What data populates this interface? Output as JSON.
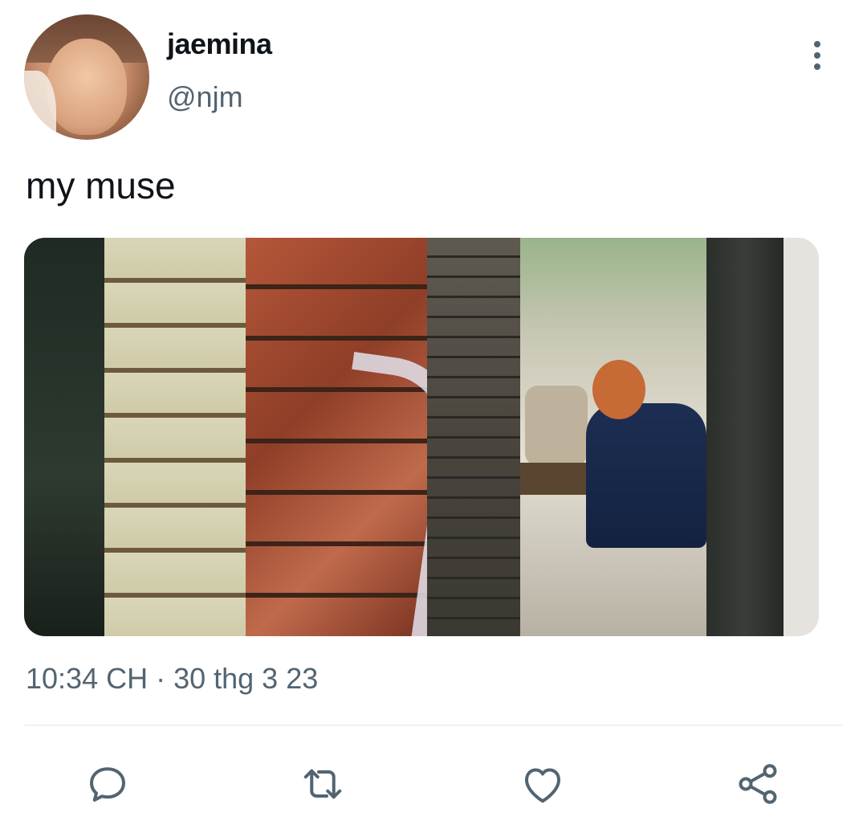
{
  "user": {
    "display_name": "jaemina",
    "handle": "@njm"
  },
  "tweet": {
    "text": "my muse",
    "timestamp": "10:34 CH · 30 thg 3 23"
  },
  "icons": {
    "more": "more-vertical-icon",
    "reply": "reply-icon",
    "retweet": "retweet-icon",
    "like": "heart-icon",
    "share": "share-icon"
  },
  "colors": {
    "text_primary": "#0f1419",
    "text_secondary": "#536471",
    "divider": "#eff3f4"
  }
}
